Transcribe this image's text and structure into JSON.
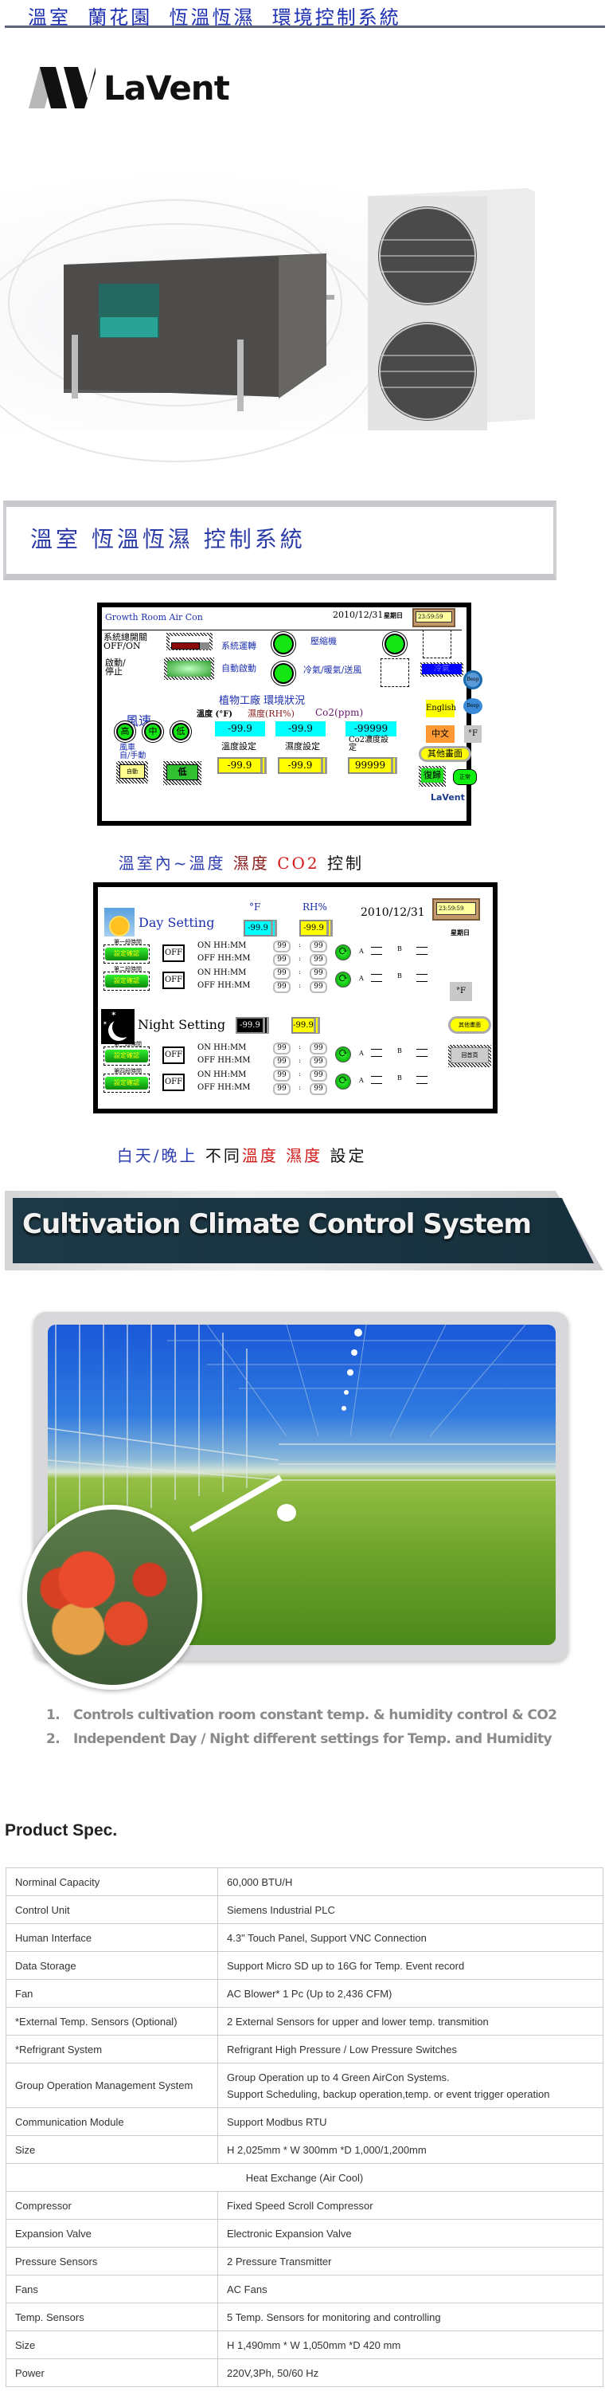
{
  "header": {
    "title": "溫室  蘭花園  恆溫恆濕  環境控制系統"
  },
  "logo": {
    "brand": "LaVent"
  },
  "hero": {
    "products": [
      "indoor-duct-air-handler",
      "outdoor-condensing-unit"
    ]
  },
  "section1": {
    "banner_text": "溫室 恆溫恆濕 控制系統"
  },
  "panel1": {
    "title": "Growth Room Air Con",
    "date": "2010/12/31",
    "weekday": "星期日",
    "time": "23:59:59",
    "system_switch_label": "系統總開關\nOFF/ON",
    "start_stop_label": "啟動/\n停止",
    "system_running": "系統運轉",
    "compressor": "壓縮機",
    "auto_start": "自動啟動",
    "mode_label": "冷氣/暖氣/送風",
    "mode_value": "冷氣",
    "section_title": "植物工廠 環境狀況",
    "fan_speed": "風速",
    "fan_buttons": [
      "高",
      "中",
      "低"
    ],
    "fan_mode_label": "風車\n自/手動",
    "fan_auto_button": "自動",
    "fan_level_button": "低",
    "temp_header": "溫度 (°F)",
    "humidity_header": "濕度(RH%)",
    "co2_header": "Co2(ppm)",
    "temp_value": "-99.9",
    "humidity_value": "-99.9",
    "co2_value": "-99999",
    "temp_set_label": "溫度設定",
    "humidity_set_label": "濕度設定",
    "co2_set_label": "Co2濃度設定",
    "temp_set_value": "-99.9",
    "humidity_set_value": "-99.9",
    "co2_set_value": "99999",
    "english_button": "English",
    "chinese_button": "中文",
    "unit_button": "°F",
    "beep_off": "Beep",
    "beep_on": "Beep",
    "other_screens_button": "其他畫面",
    "reset_button": "復歸",
    "normal_button": "正常",
    "brand": "LaVent"
  },
  "caption1": {
    "parts": [
      {
        "text": "溫室內~溫度 ",
        "color": "#2f3fb0"
      },
      {
        "text": "濕度 ",
        "color": "#8a1a1a"
      },
      {
        "text": "CO2 ",
        "color": "#d41818"
      },
      {
        "text": "控制",
        "color": "#111111"
      }
    ]
  },
  "panel2": {
    "temp_unit": "°F",
    "humidity_unit": "RH%",
    "date": "2010/12/31",
    "time": "23:59:59",
    "weekday": "星期日",
    "day_label": "Day Setting",
    "day_temp": "-99.9",
    "day_humidity": "-99.9",
    "night_label": "Night Setting",
    "night_temp": "-99.9",
    "night_humidity": "-99.9",
    "unit_button": "°F",
    "other_screens_button": "其他畫面",
    "home_button": "回首頁",
    "confirm_label": "設定確認",
    "on_label": "ON   HH:MM",
    "off_label": "OFF HH:MM",
    "a_label": "A",
    "b_label": "B",
    "colon": ":",
    "timers": [
      {
        "name": "第一段時間",
        "state": "OFF",
        "on_h": "99",
        "on_m": "99",
        "off_h": "99",
        "off_m": "99"
      },
      {
        "name": "第二段時間",
        "state": "OFF",
        "on_h": "99",
        "on_m": "99",
        "off_h": "99",
        "off_m": "99"
      },
      {
        "name": "第三段時間",
        "state": "OFF",
        "on_h": "99",
        "on_m": "99",
        "off_h": "99",
        "off_m": "99"
      },
      {
        "name": "第四段時間",
        "state": "OFF",
        "on_h": "99",
        "on_m": "99",
        "off_h": "99",
        "off_m": "99"
      }
    ]
  },
  "caption2": {
    "parts": [
      {
        "text": "白天/晚上 ",
        "color": "#2f3fb0"
      },
      {
        "text": "不同",
        "color": "#111111"
      },
      {
        "text": "溫度 ",
        "color": "#d41818"
      },
      {
        "text": "濕度 ",
        "color": "#d41818"
      },
      {
        "text": "設定",
        "color": "#111111"
      }
    ]
  },
  "section2": {
    "banner_text": "Cultivation Climate Control System"
  },
  "features": [
    {
      "num": "1.",
      "text": "Controls cultivation room constant temp. & humidity control & CO2"
    },
    {
      "num": "2.",
      "text": "Independent Day / Night different settings for Temp. and Humidity"
    }
  ],
  "spec": {
    "title": "Product Spec.",
    "rows": [
      {
        "key": "Norminal Capacity",
        "value": "60,000 BTU/H"
      },
      {
        "key": "Control Unit",
        "value": "Siemens Industrial PLC"
      },
      {
        "key": "Human Interface",
        "value": "4.3\" Touch Panel, Support VNC Connection"
      },
      {
        "key": "Data Storage",
        "value": "Support Micro SD up to 16G for Temp. Event record"
      },
      {
        "key": "Fan",
        "value": "AC Blower* 1 Pc (Up to 2,436 CFM)"
      },
      {
        "key": "*External Temp. Sensors (Optional)",
        "value": "2 External Sensors for upper and lower temp. transmition"
      },
      {
        "key": "*Refrigrant System",
        "value": "Refrigrant High Pressure / Low Pressure Switches"
      },
      {
        "key": "Group Operation Management System",
        "value": "Group Operation up to 4 Green AirCon Systems.",
        "value2": "Support Scheduling, backup operation,temp. or event trigger operation"
      },
      {
        "key": "Communication Module",
        "value": "Support Modbus RTU"
      },
      {
        "key": "Size",
        "value": "H 2,025mm * W 300mm *D 1,000/1,200mm"
      },
      {
        "section": "Heat Exchange (Air Cool)"
      },
      {
        "key": "Compressor",
        "value": "Fixed Speed Scroll Compressor"
      },
      {
        "key": "Expansion Valve",
        "value": "Electronic Expansion Valve"
      },
      {
        "key": "Pressure Sensors",
        "value": "2 Pressure Transmitter"
      },
      {
        "key": "Fans",
        "value": "AC Fans"
      },
      {
        "key": "Temp. Sensors",
        "value": "5 Temp. Sensors for monitoring and controlling"
      },
      {
        "key": "Size",
        "value": "H 1,490mm * W 1,050mm *D 420 mm"
      },
      {
        "key": "Power",
        "value": "220V,3Ph, 50/60 Hz"
      }
    ]
  }
}
